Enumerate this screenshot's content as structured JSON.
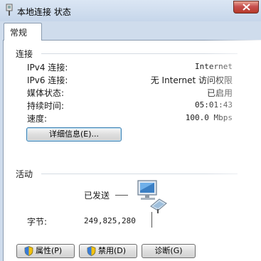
{
  "window": {
    "title": "本地连接 状态",
    "tab_label": "常规"
  },
  "connection": {
    "group_title": "连接",
    "rows": [
      {
        "label": "IPv4 连接:",
        "value": "Internet"
      },
      {
        "label": "IPv6 连接:",
        "value": "无 Internet 访问权限"
      },
      {
        "label": "媒体状态:",
        "value": "已启用"
      },
      {
        "label": "持续时间:",
        "value": "05:01:43"
      },
      {
        "label": "速度:",
        "value": "100.0 Mbps"
      }
    ],
    "details_button": "详细信息(E)..."
  },
  "activity": {
    "group_title": "活动",
    "sent_label": "已发送",
    "bytes_label": "字节:",
    "bytes_sent": "249,825,280"
  },
  "buttons": {
    "properties": "属性(P)",
    "disable": "禁用(D)",
    "diagnose": "诊断(G)"
  },
  "colors": {
    "titlebar": "#c6d6ea",
    "close_button": "#c75050",
    "focus_border": "#3c7fb1"
  },
  "icons": {
    "title": "network-adapter-icon",
    "close": "close-icon",
    "activity": "network-computer-icon",
    "shield": "uac-shield-icon"
  }
}
